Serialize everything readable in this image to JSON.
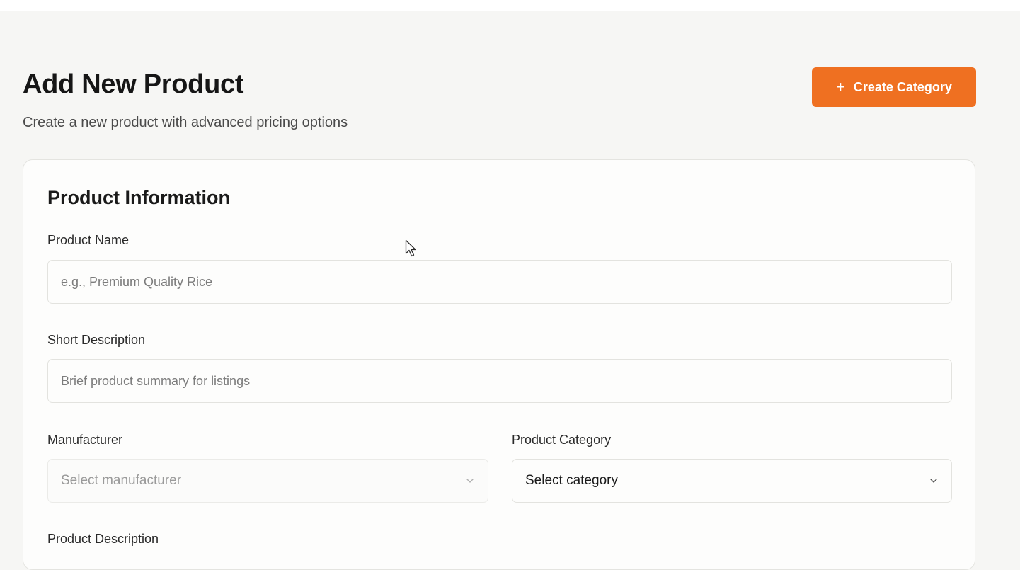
{
  "header": {
    "title": "Add New Product",
    "subtitle": "Create a new product with advanced pricing options",
    "create_category_label": "Create Category",
    "create_category_icon": "plus-icon",
    "accent_color": "#ef7021"
  },
  "card": {
    "title": "Product Information",
    "product_name": {
      "label": "Product Name",
      "value": "",
      "placeholder": "e.g., Premium Quality Rice"
    },
    "short_description": {
      "label": "Short Description",
      "value": "",
      "placeholder": "Brief product summary for listings"
    },
    "manufacturer": {
      "label": "Manufacturer",
      "selected": "Select manufacturer",
      "icon": "chevron-down-icon"
    },
    "product_category": {
      "label": "Product Category",
      "selected": "Select category",
      "icon": "chevron-down-icon"
    },
    "product_description": {
      "label": "Product Description"
    }
  }
}
